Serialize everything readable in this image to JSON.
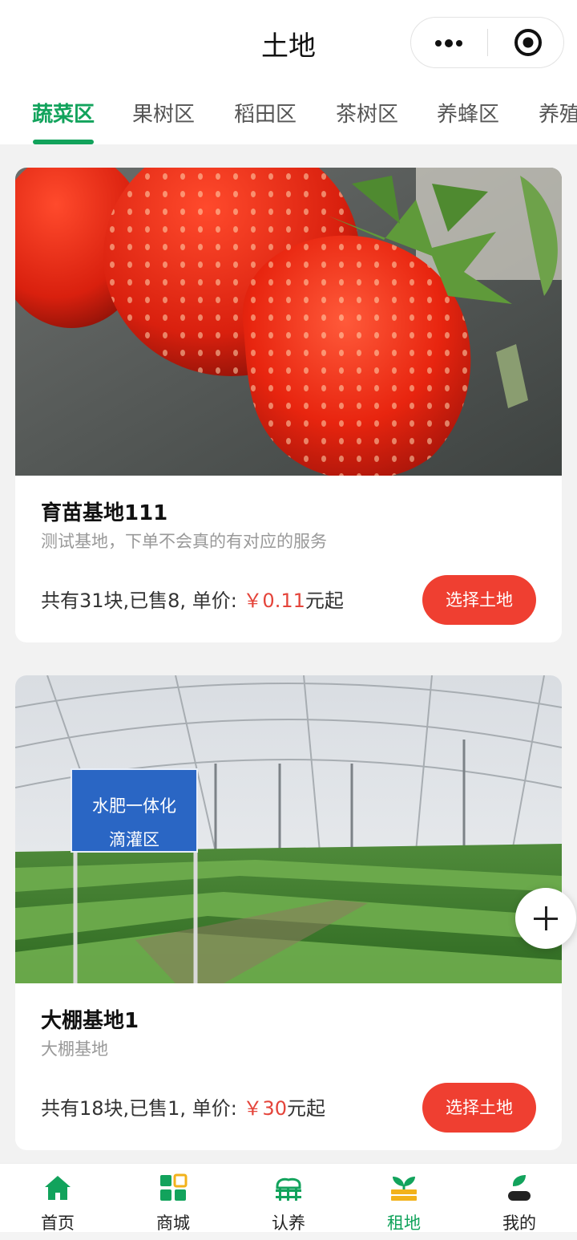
{
  "header": {
    "title": "土地"
  },
  "tabs": [
    {
      "label": "蔬菜区",
      "active": true
    },
    {
      "label": "果树区",
      "active": false
    },
    {
      "label": "稻田区",
      "active": false
    },
    {
      "label": "茶树区",
      "active": false
    },
    {
      "label": "养蜂区",
      "active": false
    },
    {
      "label": "养殖区",
      "active": false
    }
  ],
  "cards": [
    {
      "name": "育苗基地111",
      "description": "测试基地，下单不会真的有对应的服务",
      "info_prefix": "共有31块,已售8, 单价:",
      "price": "￥0.11",
      "price_suffix": "元起",
      "button_label": "选择土地",
      "image": "strawberry-photo"
    },
    {
      "name": "大棚基地1",
      "description": "大棚基地",
      "info_prefix": "共有18块,已售1, 单价:",
      "price": "￥30",
      "price_suffix": "元起",
      "button_label": "选择土地",
      "image": "greenhouse-photo",
      "image_sign_lines": [
        "水肥一体化",
        "滴灌区"
      ]
    }
  ],
  "tabbar": [
    {
      "label": "首页",
      "icon": "home-icon",
      "active": false
    },
    {
      "label": "商城",
      "icon": "mall-grid-icon",
      "active": false
    },
    {
      "label": "认养",
      "icon": "adopt-livestock-icon",
      "active": false
    },
    {
      "label": "租地",
      "icon": "rent-land-sprout-icon",
      "active": true
    },
    {
      "label": "我的",
      "icon": "profile-icon",
      "active": false
    }
  ],
  "colors": {
    "accent_green": "#12a35c",
    "price_red": "#e4443a",
    "button_red": "#ef3f31"
  }
}
